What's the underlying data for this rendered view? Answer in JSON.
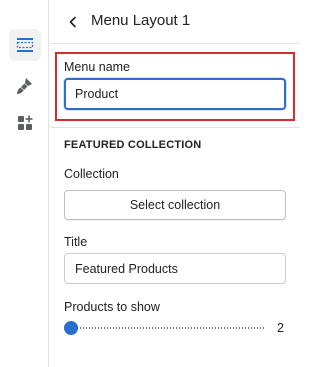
{
  "header": {
    "title": "Menu Layout 1"
  },
  "menu_name": {
    "label": "Menu name",
    "value": "Product"
  },
  "featured_collection": {
    "heading": "FEATURED COLLECTION",
    "collection_label": "Collection",
    "select_button": "Select collection",
    "title_label": "Title",
    "title_value": "Featured Products",
    "products_label": "Products to show",
    "products_value": "2",
    "products_slider_position": 0
  },
  "rail": {
    "icons": [
      "sections-icon",
      "brush-icon",
      "apps-icon"
    ],
    "active": "sections-icon"
  },
  "colors": {
    "accent": "#2c6ecb",
    "highlight": "#d82c2c",
    "border": "#e1e3e5"
  }
}
